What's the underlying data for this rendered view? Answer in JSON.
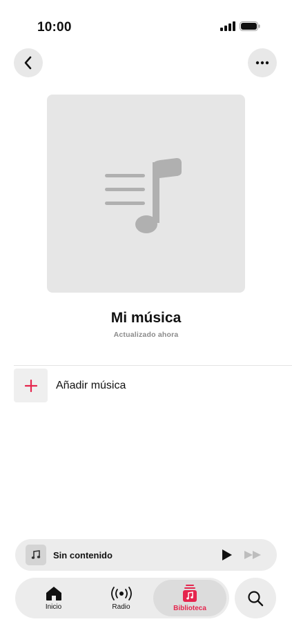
{
  "status_bar": {
    "time": "10:00"
  },
  "header": {
    "back_icon": "chevron-left-icon",
    "more_icon": "ellipsis-icon"
  },
  "playlist": {
    "title": "Mi música",
    "subtitle": "Actualizado ahora",
    "artwork_icon": "music-note-list-icon"
  },
  "actions": {
    "add_label": "Añadir música",
    "add_icon": "plus-icon"
  },
  "mini_player": {
    "title": "Sin contenido",
    "play_icon": "play-icon",
    "forward_icon": "fast-forward-icon"
  },
  "tabs": [
    {
      "label": "Inicio",
      "icon": "house-icon"
    },
    {
      "label": "Radio",
      "icon": "broadcast-icon"
    },
    {
      "label": "Biblioteca",
      "icon": "library-icon",
      "active": true
    }
  ],
  "search": {
    "icon": "search-icon"
  },
  "colors": {
    "accent": "#e5254d",
    "surface": "#ececec",
    "artwork": "#e6e6e6"
  }
}
